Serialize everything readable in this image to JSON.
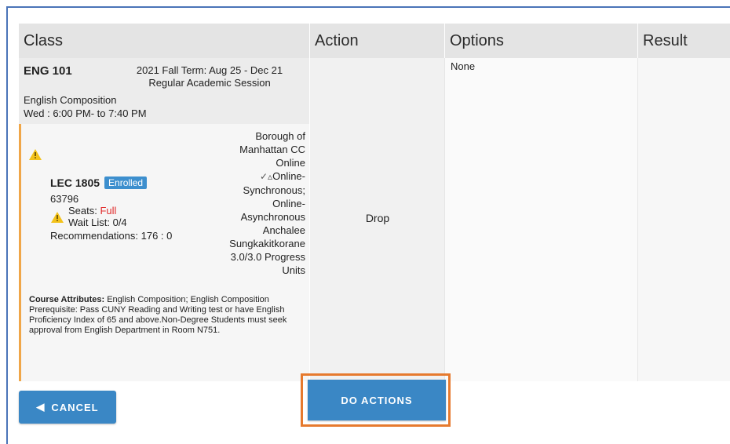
{
  "table": {
    "headers": {
      "class": "Class",
      "action": "Action",
      "options": "Options",
      "result": "Result"
    }
  },
  "course": {
    "code": "ENG 101",
    "term_line1": "2021 Fall Term: Aug 25 - Dec 21",
    "term_line2": "Regular Academic Session",
    "title": "English Composition",
    "schedule": "Wed : 6:00 PM- to 7:40 PM"
  },
  "section": {
    "component": "LEC 1805",
    "status_badge": "Enrolled",
    "class_number": "63796",
    "seats_label": "Seats:",
    "seats_value": "Full",
    "waitlist": "Wait List: 0/4",
    "recommendations": "Recommendations: 176 : 0",
    "campus_line1": "Borough of",
    "campus_line2": "Manhattan CC",
    "campus_line3": "Online",
    "mode_line1": "Online-",
    "mode_line2": "Synchronous;",
    "mode_line3": "Online-",
    "mode_line4": "Asynchronous",
    "instructor_line1": "Anchalee",
    "instructor_line2": "Sungkakitkorane",
    "units_line1": "3.0/3.0 Progress",
    "units_line2": "Units",
    "attributes_label": "Course Attributes:",
    "attributes_value": " English Composition; English Composition",
    "prerequisite": "Prerequisite: Pass CUNY Reading and Writing test or have English Proficiency Index of 65 and above.Non-Degree Students must seek approval from English Department in Room N751."
  },
  "action_cell": "Drop",
  "options_cell": "None",
  "buttons": {
    "cancel": "CANCEL",
    "do_actions": "DO ACTIONS"
  },
  "colors": {
    "primary": "#3a87c5",
    "highlight": "#e67a2e",
    "warning_border": "#f0a648",
    "full_text": "#e12c2c"
  }
}
